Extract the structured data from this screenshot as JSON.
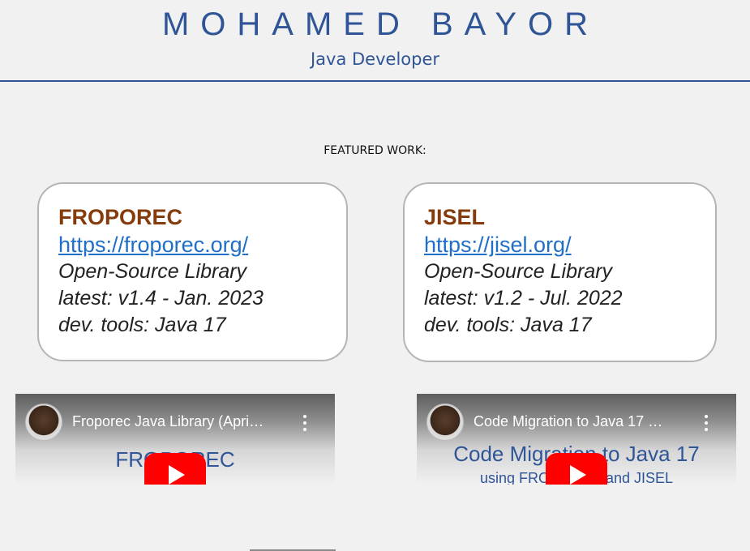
{
  "header": {
    "name": "MOHAMED BAYOR",
    "role": "Java Developer"
  },
  "featured_label": "FEATURED WORK:",
  "projects": [
    {
      "title": "FROPOREC",
      "url": "https://froporec.org/",
      "description": "Open-Source Library",
      "latest": "latest: v1.4 - Jan. 2023",
      "tools": "dev. tools: Java 17"
    },
    {
      "title": "JISEL",
      "url": "https://jisel.org/",
      "description": "Open-Source Library",
      "latest": "latest: v1.2 - Jul. 2022",
      "tools": "dev. tools: Java 17"
    }
  ],
  "videos": [
    {
      "title": "Froporec Java Library (Apri…",
      "thumb_title": "FROPOREC",
      "thumb_subtitle": ""
    },
    {
      "title": "Code Migration to Java 17 …",
      "thumb_title": "Code Migration to Java 17",
      "thumb_subtitle": "using FROPOREC and JISEL"
    }
  ],
  "colors": {
    "accent": "#2f5597",
    "project_title": "#843c0c",
    "link": "#1f6fc9",
    "play_button": "#ff0000"
  },
  "icons": {
    "play": "youtube-play-icon",
    "more": "more-vertical-icon",
    "avatar": "channel-avatar"
  }
}
